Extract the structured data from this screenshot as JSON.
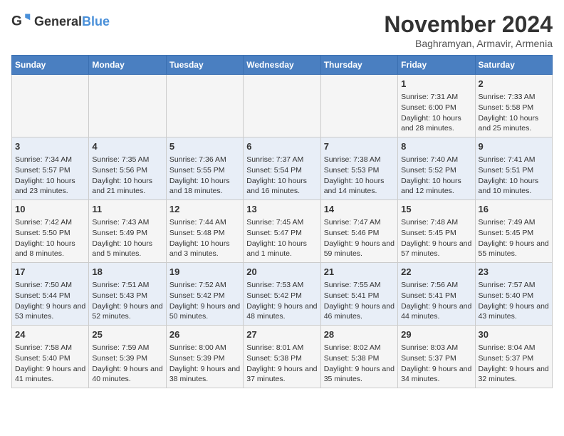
{
  "logo": {
    "general": "General",
    "blue": "Blue"
  },
  "header": {
    "title": "November 2024",
    "subtitle": "Baghramyan, Armavir, Armenia"
  },
  "weekdays": [
    "Sunday",
    "Monday",
    "Tuesday",
    "Wednesday",
    "Thursday",
    "Friday",
    "Saturday"
  ],
  "weeks": [
    [
      {
        "day": "",
        "info": ""
      },
      {
        "day": "",
        "info": ""
      },
      {
        "day": "",
        "info": ""
      },
      {
        "day": "",
        "info": ""
      },
      {
        "day": "",
        "info": ""
      },
      {
        "day": "1",
        "info": "Sunrise: 7:31 AM\nSunset: 6:00 PM\nDaylight: 10 hours and 28 minutes."
      },
      {
        "day": "2",
        "info": "Sunrise: 7:33 AM\nSunset: 5:58 PM\nDaylight: 10 hours and 25 minutes."
      }
    ],
    [
      {
        "day": "3",
        "info": "Sunrise: 7:34 AM\nSunset: 5:57 PM\nDaylight: 10 hours and 23 minutes."
      },
      {
        "day": "4",
        "info": "Sunrise: 7:35 AM\nSunset: 5:56 PM\nDaylight: 10 hours and 21 minutes."
      },
      {
        "day": "5",
        "info": "Sunrise: 7:36 AM\nSunset: 5:55 PM\nDaylight: 10 hours and 18 minutes."
      },
      {
        "day": "6",
        "info": "Sunrise: 7:37 AM\nSunset: 5:54 PM\nDaylight: 10 hours and 16 minutes."
      },
      {
        "day": "7",
        "info": "Sunrise: 7:38 AM\nSunset: 5:53 PM\nDaylight: 10 hours and 14 minutes."
      },
      {
        "day": "8",
        "info": "Sunrise: 7:40 AM\nSunset: 5:52 PM\nDaylight: 10 hours and 12 minutes."
      },
      {
        "day": "9",
        "info": "Sunrise: 7:41 AM\nSunset: 5:51 PM\nDaylight: 10 hours and 10 minutes."
      }
    ],
    [
      {
        "day": "10",
        "info": "Sunrise: 7:42 AM\nSunset: 5:50 PM\nDaylight: 10 hours and 8 minutes."
      },
      {
        "day": "11",
        "info": "Sunrise: 7:43 AM\nSunset: 5:49 PM\nDaylight: 10 hours and 5 minutes."
      },
      {
        "day": "12",
        "info": "Sunrise: 7:44 AM\nSunset: 5:48 PM\nDaylight: 10 hours and 3 minutes."
      },
      {
        "day": "13",
        "info": "Sunrise: 7:45 AM\nSunset: 5:47 PM\nDaylight: 10 hours and 1 minute."
      },
      {
        "day": "14",
        "info": "Sunrise: 7:47 AM\nSunset: 5:46 PM\nDaylight: 9 hours and 59 minutes."
      },
      {
        "day": "15",
        "info": "Sunrise: 7:48 AM\nSunset: 5:45 PM\nDaylight: 9 hours and 57 minutes."
      },
      {
        "day": "16",
        "info": "Sunrise: 7:49 AM\nSunset: 5:45 PM\nDaylight: 9 hours and 55 minutes."
      }
    ],
    [
      {
        "day": "17",
        "info": "Sunrise: 7:50 AM\nSunset: 5:44 PM\nDaylight: 9 hours and 53 minutes."
      },
      {
        "day": "18",
        "info": "Sunrise: 7:51 AM\nSunset: 5:43 PM\nDaylight: 9 hours and 52 minutes."
      },
      {
        "day": "19",
        "info": "Sunrise: 7:52 AM\nSunset: 5:42 PM\nDaylight: 9 hours and 50 minutes."
      },
      {
        "day": "20",
        "info": "Sunrise: 7:53 AM\nSunset: 5:42 PM\nDaylight: 9 hours and 48 minutes."
      },
      {
        "day": "21",
        "info": "Sunrise: 7:55 AM\nSunset: 5:41 PM\nDaylight: 9 hours and 46 minutes."
      },
      {
        "day": "22",
        "info": "Sunrise: 7:56 AM\nSunset: 5:41 PM\nDaylight: 9 hours and 44 minutes."
      },
      {
        "day": "23",
        "info": "Sunrise: 7:57 AM\nSunset: 5:40 PM\nDaylight: 9 hours and 43 minutes."
      }
    ],
    [
      {
        "day": "24",
        "info": "Sunrise: 7:58 AM\nSunset: 5:40 PM\nDaylight: 9 hours and 41 minutes."
      },
      {
        "day": "25",
        "info": "Sunrise: 7:59 AM\nSunset: 5:39 PM\nDaylight: 9 hours and 40 minutes."
      },
      {
        "day": "26",
        "info": "Sunrise: 8:00 AM\nSunset: 5:39 PM\nDaylight: 9 hours and 38 minutes."
      },
      {
        "day": "27",
        "info": "Sunrise: 8:01 AM\nSunset: 5:38 PM\nDaylight: 9 hours and 37 minutes."
      },
      {
        "day": "28",
        "info": "Sunrise: 8:02 AM\nSunset: 5:38 PM\nDaylight: 9 hours and 35 minutes."
      },
      {
        "day": "29",
        "info": "Sunrise: 8:03 AM\nSunset: 5:37 PM\nDaylight: 9 hours and 34 minutes."
      },
      {
        "day": "30",
        "info": "Sunrise: 8:04 AM\nSunset: 5:37 PM\nDaylight: 9 hours and 32 minutes."
      }
    ]
  ]
}
